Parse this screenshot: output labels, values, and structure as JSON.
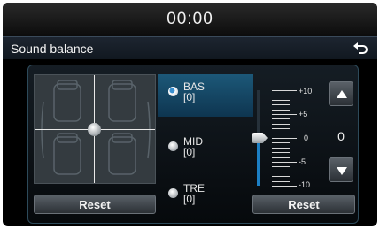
{
  "status_bar": {
    "clock": "00:00"
  },
  "header": {
    "title": "Sound balance",
    "back_icon": "back-arrow-icon"
  },
  "balance_fader": {
    "reset_label": "Reset"
  },
  "equalizer": {
    "bands": [
      {
        "name": "BAS",
        "value": "[0]",
        "selected": true
      },
      {
        "name": "MID",
        "value": "[0]",
        "selected": false
      },
      {
        "name": "TRE",
        "value": "[0]",
        "selected": false
      }
    ],
    "scale": [
      "+10",
      "+5",
      "0",
      "-5",
      "-10"
    ],
    "current_value": "0",
    "reset_label": "Reset",
    "level_fraction": 0.5
  },
  "colors": {
    "accent": "#1c7fc4",
    "selected_band_bg": "#1c5878"
  }
}
